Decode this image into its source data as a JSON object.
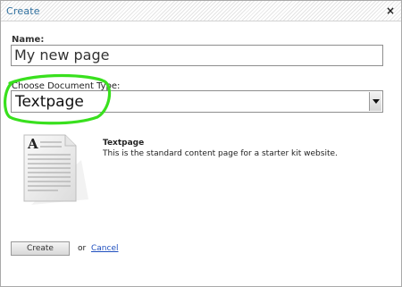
{
  "dialog": {
    "title": "Create",
    "close_symbol": "×"
  },
  "form": {
    "name_label": "Name:",
    "name_value": "My new page",
    "type_label": "Choose Document Type:",
    "type_selected": "Textpage",
    "type_options": [
      "Textpage"
    ]
  },
  "description": {
    "title": "Textpage",
    "text": "This is the standard content page for a starter kit website.",
    "icon_letter": "A"
  },
  "actions": {
    "create_label": "Create",
    "or_text": "or",
    "cancel_label": "Cancel"
  },
  "colors": {
    "accent_title": "#2f6f9e",
    "highlight_green": "#39e01e",
    "link_blue": "#1f4fbf"
  },
  "icons": {
    "close": "close-icon",
    "document": "document-icon",
    "dropdown": "chevron-down-icon"
  }
}
